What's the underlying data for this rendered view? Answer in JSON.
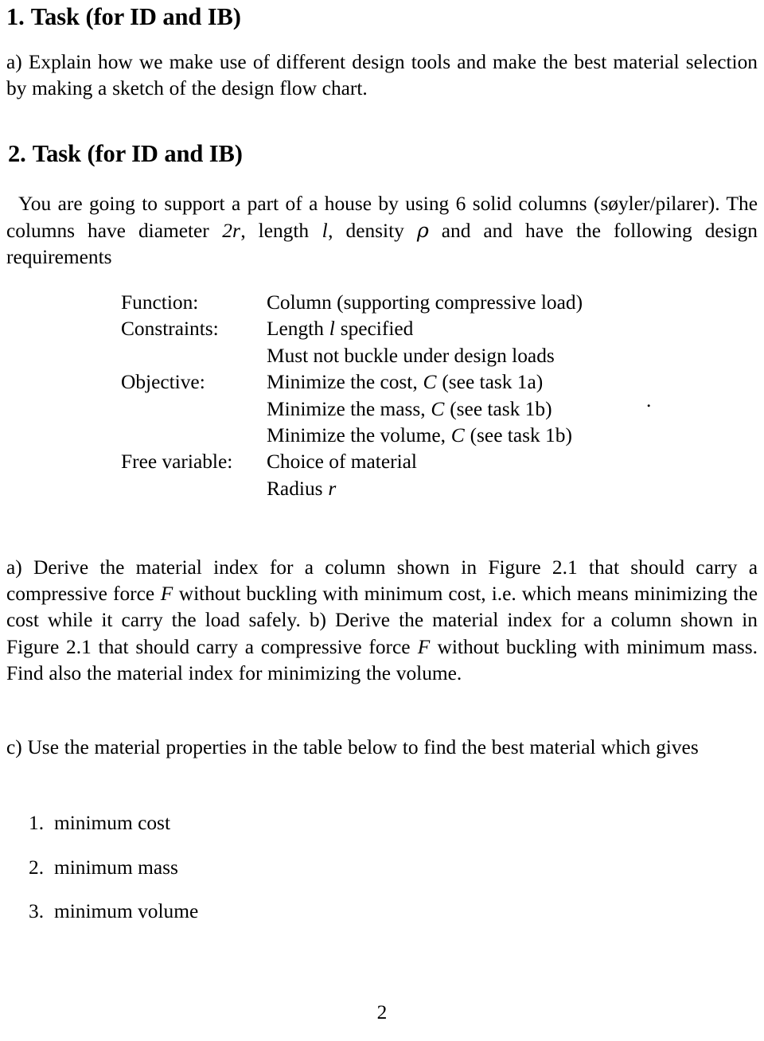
{
  "document": {
    "page_number": "2",
    "stray_mark": "."
  },
  "sections": [
    {
      "heading_number": "1.",
      "heading_title": "Task (for ID and IB)"
    },
    {
      "heading_number": "2.",
      "heading_title": "Task (for ID and IB)"
    }
  ],
  "task1": {
    "item_a": {
      "label": "a)",
      "text_before": "Explain how we make use of different design tools and make the best material selection by making a sketch of the design flow chart."
    }
  },
  "task2": {
    "intro": {
      "part1": "You are going to support a part of a house by using 6 solid columns (søyler/pilarer). The columns have diameter ",
      "math_2r": "2r",
      "part2": ", length ",
      "math_l": "l",
      "part3": ", density ",
      "math_rho": "ρ",
      "part4": " and and have the following design requirements"
    },
    "spec": {
      "rows": [
        {
          "label": "Function:",
          "value_pre": "Column (supporting compressive load)",
          "math": "",
          "value_post": ""
        },
        {
          "label": "Constraints:",
          "value_pre": "Length ",
          "math": "l",
          "value_post": " specified"
        },
        {
          "label": "",
          "value_pre": "Must not buckle under design loads",
          "math": "",
          "value_post": ""
        },
        {
          "label": "Objective:",
          "value_pre": "Minimize the cost, ",
          "math": "C",
          "value_post": " (see task 1a)"
        },
        {
          "label": "",
          "value_pre": "Minimize the mass, ",
          "math": "C",
          "value_post": " (see task 1b)"
        },
        {
          "label": "",
          "value_pre": "Minimize the volume, ",
          "math": "C",
          "value_post": " (see task 1b)"
        },
        {
          "label": "Free variable:",
          "value_pre": "Choice of material",
          "math": "",
          "value_post": ""
        },
        {
          "label": "",
          "value_pre": "Radius ",
          "math": "r",
          "value_post": ""
        }
      ]
    },
    "item_a": {
      "p1": "a) Derive the material index for a column shown in Figure 2.1 that should carry a compressive force ",
      "math_F1": "F",
      "p2": " without buckling with minimum cost, i.e.  which means minimizing the cost while it carry the load safely. b) Derive the material index for a column shown in Figure 2.1 that should carry a compressive force ",
      "math_F2": "F",
      "p3": " without buckling with minimum mass.  Find also the material index for minimizing the volume."
    },
    "item_c": {
      "text": "c) Use the material properties in the table below to find the best material which gives"
    },
    "list": [
      {
        "number": "1.",
        "label": "minimum cost"
      },
      {
        "number": "2.",
        "label": "minimum mass"
      },
      {
        "number": "3.",
        "label": "minimum volume"
      }
    ]
  }
}
